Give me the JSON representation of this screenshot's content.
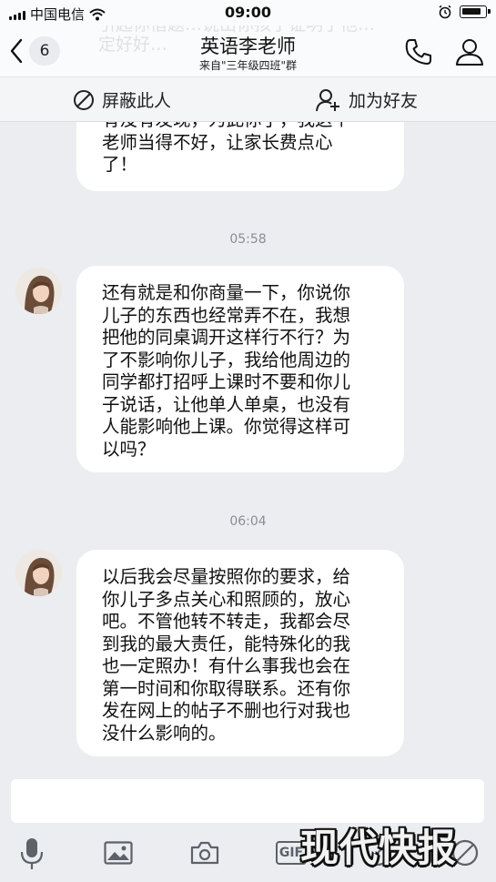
{
  "status_bar": {
    "carrier": "中国电信",
    "time": "09:00"
  },
  "nav": {
    "back_count": "6",
    "title": "英语李老师",
    "subtitle": "来自\"三年级四班\"群",
    "ghost_text": "引起你借题…说出你孩子证明了他…一定好好…"
  },
  "actions": {
    "block_label": "屏蔽此人",
    "add_friend_label": "加为好友"
  },
  "messages": [
    {
      "lines": [
        "有没有发现，为此你了，我这个",
        "老师当得不好，让家长费点心",
        "了！"
      ]
    },
    {
      "timestamp": "05:58",
      "lines": [
        "还有就是和你商量一下，你说你",
        "儿子的东西也经常弄不在，我想",
        "把他的同桌调开这样行不行？为",
        "了不影响你儿子，我给他周边的",
        "同学都打招呼上课时不要和你儿",
        "子说话，让他单人单桌，也没有",
        "人能影响他上课。你觉得这样可",
        "以吗？"
      ]
    },
    {
      "timestamp": "06:04",
      "lines": [
        "以后我会尽量按照你的要求，给",
        "你儿子多点关心和照顾的，放心",
        "吧。不管他转不转走，我都会尽",
        "到我的最大责任，能特殊化的我",
        "也一定照办！有什么事我也会在",
        "第一时间和你取得联系。还有你",
        "发在网上的帖子不删也行对我也",
        "没什么影响的。"
      ]
    }
  ],
  "toolbar": {
    "gif_label": "GIF",
    "icons": [
      "mic-icon",
      "image-icon",
      "camera-icon",
      "gif-icon",
      "red-packet-icon",
      "emoji-icon"
    ]
  },
  "watermark": "现代快报",
  "colors": {
    "background": "#ebedf1",
    "bubble": "#ffffff",
    "timestamp": "#8a8d93"
  }
}
